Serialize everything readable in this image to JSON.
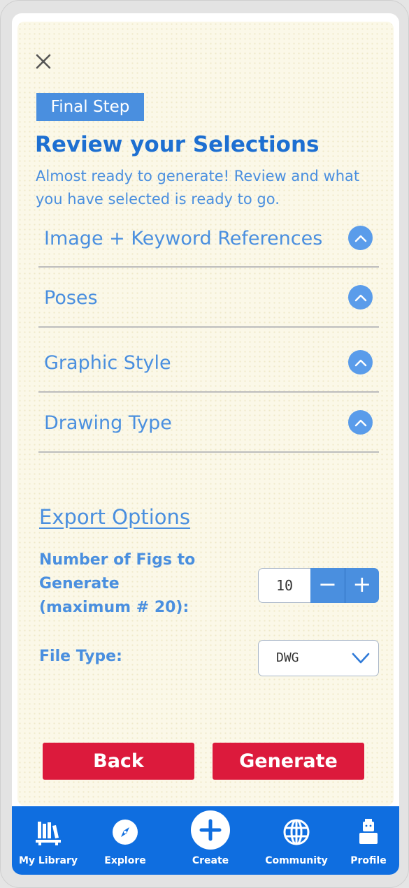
{
  "header": {
    "step_badge": "Final Step"
  },
  "title": "Review your Selections",
  "subtitle": "Almost ready to generate! Review and what you have selected is ready to go.",
  "sections": [
    {
      "label": "Image + Keyword References",
      "icon": "chevron-up-icon"
    },
    {
      "label": "Poses",
      "icon": "chevron-up-icon"
    },
    {
      "label": "Graphic Style",
      "icon": "chevron-up-icon"
    },
    {
      "label": "Drawing Type",
      "icon": "chevron-up-icon"
    }
  ],
  "export": {
    "title": "Export Options",
    "figs_label": "Number of Figs to Generate (maximum # 20):",
    "figs_value": "10",
    "minus_symbol": "−",
    "plus_symbol": "+",
    "file_type_label": "File Type:",
    "file_type_value": "DWG"
  },
  "actions": {
    "back": "Back",
    "generate": "Generate"
  },
  "nav": [
    {
      "label": "My Library",
      "icon": "library-books-icon"
    },
    {
      "label": "Explore",
      "icon": "compass-icon"
    },
    {
      "label": "Create",
      "icon": "plus-circle-icon"
    },
    {
      "label": "Community",
      "icon": "globe-icon"
    },
    {
      "label": "Profile",
      "icon": "figure-icon"
    }
  ],
  "colors": {
    "accent_blue": "#4a8fdf",
    "title_blue": "#1d6fd1",
    "nav_blue": "#0f6ee0",
    "action_red": "#dc1a3c",
    "paper": "#fbf8e8"
  }
}
